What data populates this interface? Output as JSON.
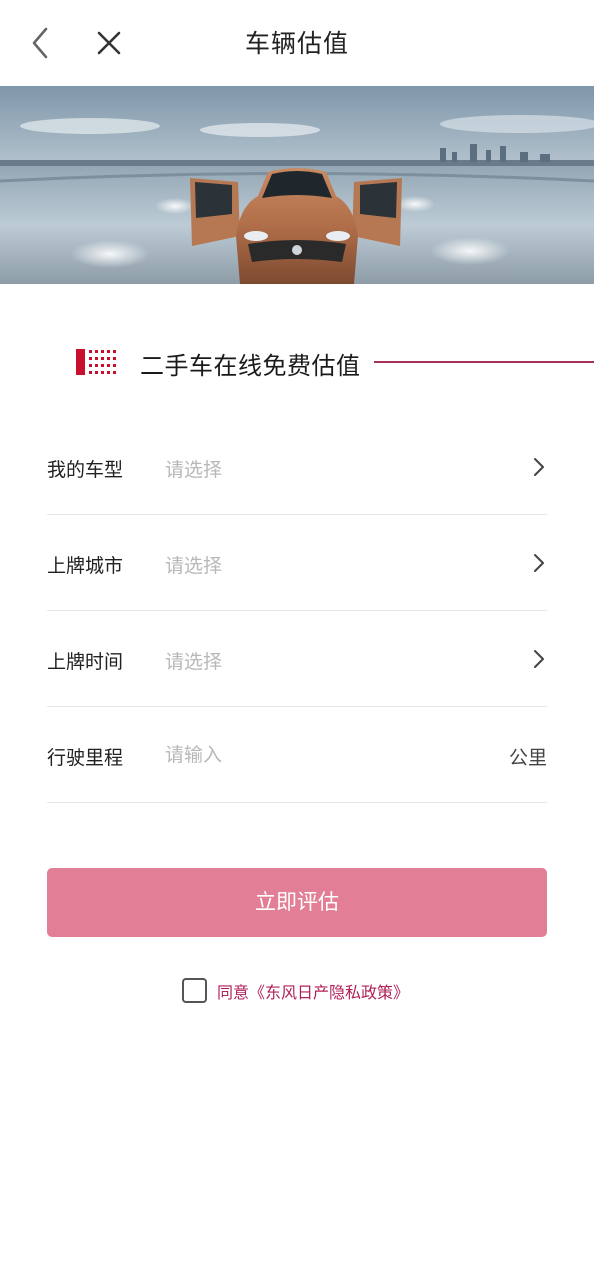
{
  "nav": {
    "title": "车辆估值",
    "back_icon": "chevron-left-icon",
    "close_icon": "close-icon"
  },
  "banner": {
    "image": "orange-nissan-car-doors-open-city-skyline"
  },
  "section": {
    "title": "二手车在线免费估值",
    "accent_color": "#a6305a"
  },
  "form": {
    "rows": [
      {
        "label": "我的车型",
        "value": "请选择"
      },
      {
        "label": "上牌城市",
        "value": "请选择"
      },
      {
        "label": "上牌时间",
        "value": "请选择"
      }
    ],
    "mileage": {
      "label": "行驶里程",
      "placeholder": "请输入",
      "unit": "公里"
    }
  },
  "submit": {
    "label": "立即评估",
    "color": "#e27f96"
  },
  "agreement": {
    "text": "同意《东风日产隐私政策》",
    "checked": false,
    "color": "#b01f5a"
  }
}
